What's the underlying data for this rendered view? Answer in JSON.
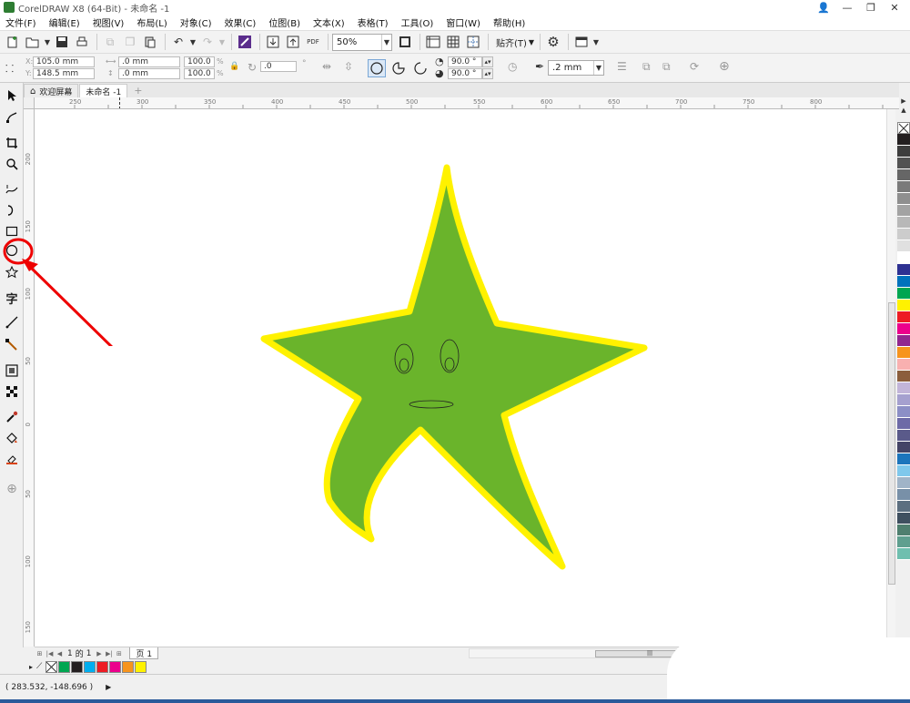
{
  "window": {
    "title": "CorelDRAW X8 (64-Bit) - 未命名 -1",
    "controls": [
      "👤",
      "—",
      "❐",
      "✕"
    ]
  },
  "menu": [
    "文件(F)",
    "编辑(E)",
    "视图(V)",
    "布局(L)",
    "对象(C)",
    "效果(C)",
    "位图(B)",
    "文本(X)",
    "表格(T)",
    "工具(O)",
    "窗口(W)",
    "帮助(H)"
  ],
  "toolbar": {
    "zoom": "50%",
    "snap_label": "贴齐(T)",
    "pdf_label": "PDF"
  },
  "properties": {
    "x": "105.0 mm",
    "y": "148.5 mm",
    "width": ".0 mm",
    "height": ".0 mm",
    "scale_w": "100.0",
    "scale_h": "100.0",
    "percent": "%",
    "rotation": ".0",
    "start_angle": "90.0 °",
    "end_angle": "90.0 °",
    "outline_width": ".2 mm"
  },
  "tabs": [
    {
      "label": "欢迎屏幕",
      "icon": "home-icon"
    },
    {
      "label": "未命名 -1",
      "icon": ""
    }
  ],
  "ruler_h": [
    "250",
    "300",
    "350",
    "400",
    "450",
    "500",
    "550",
    "600",
    "650",
    "700",
    "750",
    "800"
  ],
  "ruler_v": [
    "200",
    "150",
    "100",
    "50",
    "0",
    "50",
    "100",
    "150"
  ],
  "page_nav": {
    "current": "1",
    "of": "的",
    "total": "1",
    "page_tab": "页 1"
  },
  "status": {
    "coordinates": "( 283.532, -148.696 )",
    "fill_none": "无"
  },
  "drawing": {
    "fill": "#6ab42b",
    "outline": "#fff200"
  },
  "palette_colors": [
    "#231f20",
    "#3d3d3d",
    "#525252",
    "#666666",
    "#7a7a7a",
    "#8f8f8f",
    "#a3a3a3",
    "#b8b8b8",
    "#cccccc",
    "#e0e0e0",
    "#ffffff",
    "#2e3192",
    "#0072bc",
    "#00a651",
    "#fff200",
    "#ed1c24",
    "#ec008c",
    "#92278f",
    "#f7941d",
    "#f9b0b0",
    "#8b5e3c",
    "#c2b5d9",
    "#a5a0cf",
    "#8c8fc6",
    "#6d6aa7",
    "#5a5a8a",
    "#444466",
    "#1c75bc",
    "#7fc8ec",
    "#a0b4c8",
    "#7890a8",
    "#5c6f80",
    "#3f5060",
    "#4f7f6f",
    "#5f9f8f",
    "#6fbfaf"
  ],
  "document_palette": [
    "#ffffff",
    "#00a651",
    "#231f20",
    "#00aeef",
    "#ed1c24",
    "#ec008c",
    "#f7941d",
    "#fff200"
  ]
}
